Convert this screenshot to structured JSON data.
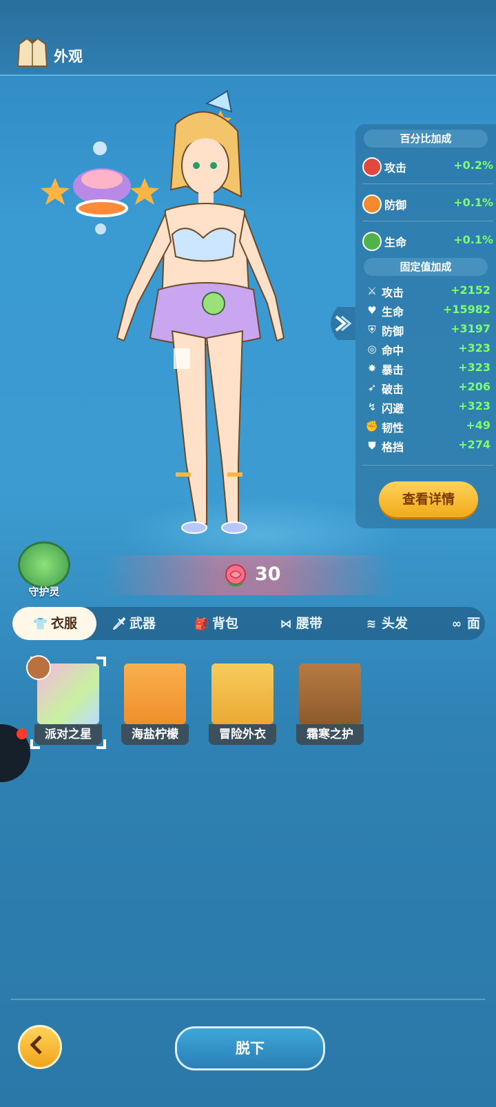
{
  "header": {
    "title": "外观"
  },
  "stats": {
    "percent_title": "百分比加成",
    "percent": [
      {
        "label": "攻击",
        "value": "+0.2%",
        "icon": "sword-icon",
        "color": "#e2483f"
      },
      {
        "label": "防御",
        "value": "+0.1%",
        "icon": "shield-icon",
        "color": "#f28a2e"
      },
      {
        "label": "生命",
        "value": "+0.1%",
        "icon": "heart-icon",
        "color": "#4fb34a"
      }
    ],
    "fixed_title": "固定值加成",
    "fixed": [
      {
        "label": "攻击",
        "value": "+2152",
        "icon": "sword-icon"
      },
      {
        "label": "生命",
        "value": "+15982",
        "icon": "heart-icon"
      },
      {
        "label": "防御",
        "value": "+3197",
        "icon": "shield-icon"
      },
      {
        "label": "命中",
        "value": "+323",
        "icon": "target-icon"
      },
      {
        "label": "暴击",
        "value": "+323",
        "icon": "crit-icon"
      },
      {
        "label": "破击",
        "value": "+206",
        "icon": "break-icon"
      },
      {
        "label": "闪避",
        "value": "+323",
        "icon": "dodge-icon"
      },
      {
        "label": "韧性",
        "value": "+49",
        "icon": "muscle-icon"
      },
      {
        "label": "格挡",
        "value": "+274",
        "icon": "block-icon"
      }
    ],
    "detail_button": "查看详情"
  },
  "guardian": {
    "label": "守护灵"
  },
  "power": {
    "value": "30"
  },
  "tabs": [
    {
      "label": "衣服",
      "icon": "shirt-icon"
    },
    {
      "label": "武器",
      "icon": "weapon-icon"
    },
    {
      "label": "背包",
      "icon": "backpack-icon"
    },
    {
      "label": "腰带",
      "icon": "belt-icon"
    },
    {
      "label": "头发",
      "icon": "hair-icon"
    },
    {
      "label": "面",
      "icon": "mask-icon"
    }
  ],
  "items": [
    {
      "label": "派对之星",
      "bg": "#d9f0b8"
    },
    {
      "label": "海盐柠檬",
      "bg": "#f7a54a"
    },
    {
      "label": "冒险外衣",
      "bg": "#f5c04a"
    },
    {
      "label": "霜寒之护",
      "bg": "#a86d3a"
    }
  ],
  "buttons": {
    "take_off": "脱下"
  }
}
